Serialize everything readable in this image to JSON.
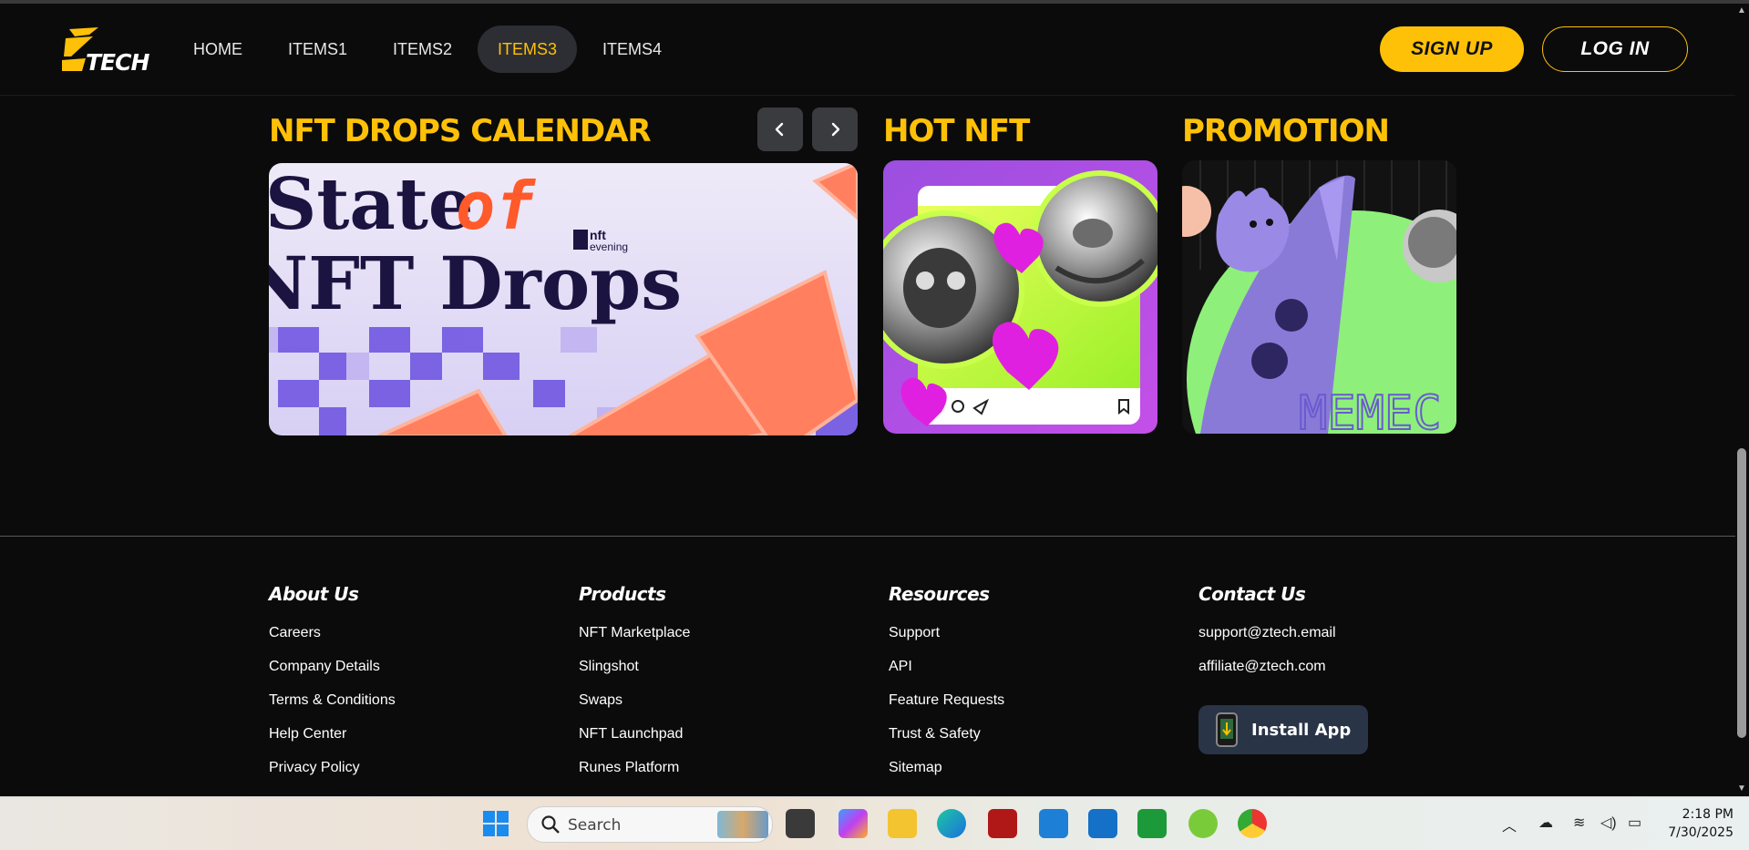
{
  "brand": {
    "name": "TECH",
    "yellow": "#ffc107"
  },
  "nav": {
    "items": [
      "HOME",
      "ITEMS1",
      "ITEMS2",
      "ITEMS3",
      "ITEMS4"
    ],
    "active_index": 3,
    "signup": "SIGN UP",
    "login": "LOG IN"
  },
  "sections": {
    "calendar": {
      "title": "NFT DROPS CALENDAR",
      "banner_line1_a": "State",
      "banner_line1_b": "of",
      "banner_line2": "NFT Drops",
      "banner_brand_top": "nft",
      "banner_brand_bottom": "evening"
    },
    "hot": {
      "title": "HOT NFT"
    },
    "promo": {
      "title": "PROMOTION",
      "card_text": "MEMEC"
    }
  },
  "footer": {
    "about": {
      "title": "About Us",
      "links": [
        "Careers",
        "Company Details",
        "Terms & Conditions",
        "Help Center",
        "Privacy Policy"
      ]
    },
    "products": {
      "title": "Products",
      "links": [
        "NFT Marketplace",
        "Slingshot",
        "Swaps",
        "NFT Launchpad",
        "Runes Platform"
      ]
    },
    "resources": {
      "title": "Resources",
      "links": [
        "Support",
        "API",
        "Feature Requests",
        "Trust & Safety",
        "Sitemap"
      ]
    },
    "contact": {
      "title": "Contact Us",
      "links": [
        "support@ztech.email",
        "affiliate@ztech.com"
      ],
      "install": "Install App"
    }
  },
  "taskbar": {
    "search_placeholder": "Search",
    "time": "2:18 PM",
    "date": "7/30/2025"
  }
}
